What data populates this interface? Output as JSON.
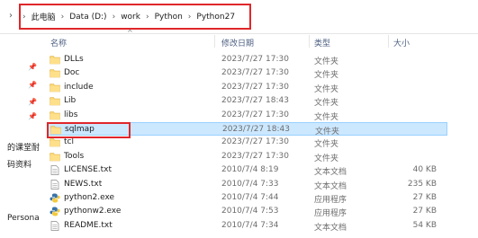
{
  "breadcrumbs": [
    "此电脑",
    "Data (D:)",
    "work",
    "Python",
    "Python27"
  ],
  "columns": {
    "name": "名称",
    "date": "修改日期",
    "type": "类型",
    "size": "大小"
  },
  "left_nav": [
    "的课堂耐",
    "码资料",
    "Persona"
  ],
  "files": [
    {
      "name": "DLLs",
      "date": "2023/7/27 17:30",
      "type": "文件夹",
      "size": "",
      "icon": "folder-icon"
    },
    {
      "name": "Doc",
      "date": "2023/7/27 17:30",
      "type": "文件夹",
      "size": "",
      "icon": "folder-icon"
    },
    {
      "name": "include",
      "date": "2023/7/27 17:30",
      "type": "文件夹",
      "size": "",
      "icon": "folder-icon"
    },
    {
      "name": "Lib",
      "date": "2023/7/27 18:43",
      "type": "文件夹",
      "size": "",
      "icon": "folder-icon"
    },
    {
      "name": "libs",
      "date": "2023/7/27 17:30",
      "type": "文件夹",
      "size": "",
      "icon": "folder-icon"
    },
    {
      "name": "sqlmap",
      "date": "2023/7/27 18:43",
      "type": "文件夹",
      "size": "",
      "icon": "folder-icon",
      "selected": true
    },
    {
      "name": "tcl",
      "date": "2023/7/27 17:30",
      "type": "文件夹",
      "size": "",
      "icon": "folder-icon"
    },
    {
      "name": "Tools",
      "date": "2023/7/27 17:30",
      "type": "文件夹",
      "size": "",
      "icon": "folder-icon"
    },
    {
      "name": "LICENSE.txt",
      "date": "2010/7/4 8:19",
      "type": "文本文档",
      "size": "40 KB",
      "icon": "text-file-icon"
    },
    {
      "name": "NEWS.txt",
      "date": "2010/7/4 7:33",
      "type": "文本文档",
      "size": "235 KB",
      "icon": "text-file-icon"
    },
    {
      "name": "python2.exe",
      "date": "2010/7/4 7:44",
      "type": "应用程序",
      "size": "27 KB",
      "icon": "python-icon"
    },
    {
      "name": "pythonw2.exe",
      "date": "2010/7/4 7:53",
      "type": "应用程序",
      "size": "27 KB",
      "icon": "python-icon"
    },
    {
      "name": "README.txt",
      "date": "2010/7/4 7:34",
      "type": "文本文档",
      "size": "54 KB",
      "icon": "text-file-icon"
    }
  ],
  "colors": {
    "annotation_red": "#e0262a",
    "selection_fill": "#cce8ff",
    "selection_border": "#99d1ff",
    "folder_yellow": "#f8d775",
    "header_text": "#4d6082"
  }
}
